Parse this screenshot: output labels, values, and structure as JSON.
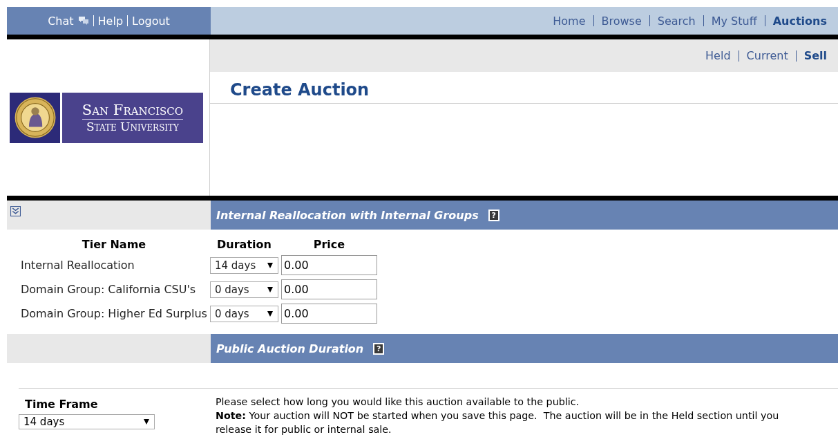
{
  "top_bar": {
    "left_links": [
      {
        "label": "Chat",
        "icon": true
      },
      {
        "label": "Help",
        "icon": false
      },
      {
        "label": "Logout",
        "icon": false
      }
    ],
    "main_nav": [
      {
        "label": "Home",
        "selected": false
      },
      {
        "label": "Browse",
        "selected": false
      },
      {
        "label": "Search",
        "selected": false
      },
      {
        "label": "My Stuff",
        "selected": false
      },
      {
        "label": "Auctions",
        "selected": true
      }
    ]
  },
  "logo": {
    "line_1": "San Francisco",
    "line_2": "State University"
  },
  "sub_nav": [
    {
      "label": "Held",
      "selected": false
    },
    {
      "label": "Current",
      "selected": false
    },
    {
      "label": "Sell",
      "selected": true
    }
  ],
  "page_title": "Create Auction",
  "internal_section": {
    "title": "Internal Reallocation with Internal Groups",
    "help": "?",
    "collapsed": false,
    "columns": [
      "Tier Name",
      "Duration",
      "Price"
    ],
    "rows": [
      {
        "tier": "Internal Reallocation",
        "duration": "14 days",
        "price": "0.00"
      },
      {
        "tier": "Domain Group: California CSU's",
        "duration": "0 days",
        "price": "0.00"
      },
      {
        "tier": "Domain Group: Higher Ed Surplus",
        "duration": "0 days",
        "price": "0.00"
      }
    ]
  },
  "public_section": {
    "title": "Public Auction Duration",
    "help": "?",
    "time_frame_label": "Time Frame",
    "time_frame": "14 days",
    "description": "Please select how long you would like this auction available to the public.",
    "note": "**Note:** Your auction will NOT be started when you save this page.  The auction will be in the Held section until you release it for public or internal sale."
  }
}
